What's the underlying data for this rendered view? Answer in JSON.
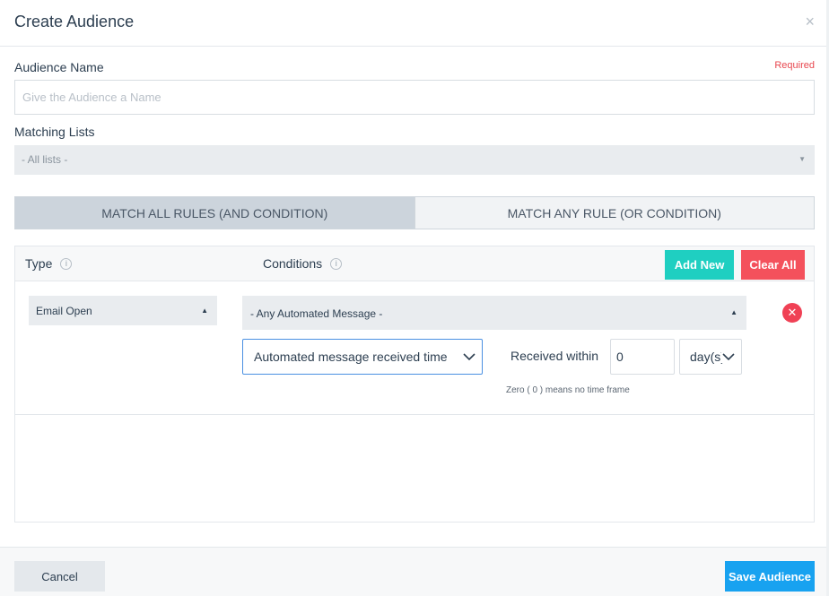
{
  "modal": {
    "title": "Create Audience",
    "close_glyph": "×"
  },
  "audience_name": {
    "label": "Audience Name",
    "required": "Required",
    "placeholder": "Give the Audience a Name",
    "value": ""
  },
  "matching_lists": {
    "label": "Matching Lists",
    "selected": "- All lists -"
  },
  "match_toggle": {
    "all_label": "MATCH ALL RULES (AND CONDITION)",
    "any_label": "MATCH ANY RULE (OR CONDITION)",
    "active": "all"
  },
  "rules": {
    "type_header": "Type",
    "conditions_header": "Conditions",
    "add_new_label": "Add New",
    "clear_all_label": "Clear All",
    "row": {
      "type": "Email Open",
      "message": "- Any Automated Message -",
      "timing": "Automated message received time",
      "received_label": "Received within",
      "received_value": "0",
      "unit": "day(s)",
      "hint": "Zero ( 0 ) means no time frame"
    }
  },
  "footer": {
    "cancel_label": "Cancel",
    "save_label": "Save Audience"
  },
  "colors": {
    "accent_add": "#1fcfc1",
    "accent_clear": "#f4515c",
    "accent_save": "#18a2f0",
    "required": "#e8474f"
  },
  "icons": [
    "close-icon",
    "info-icon",
    "caret-up-icon",
    "remove-icon",
    "chevron-down-icon"
  ]
}
